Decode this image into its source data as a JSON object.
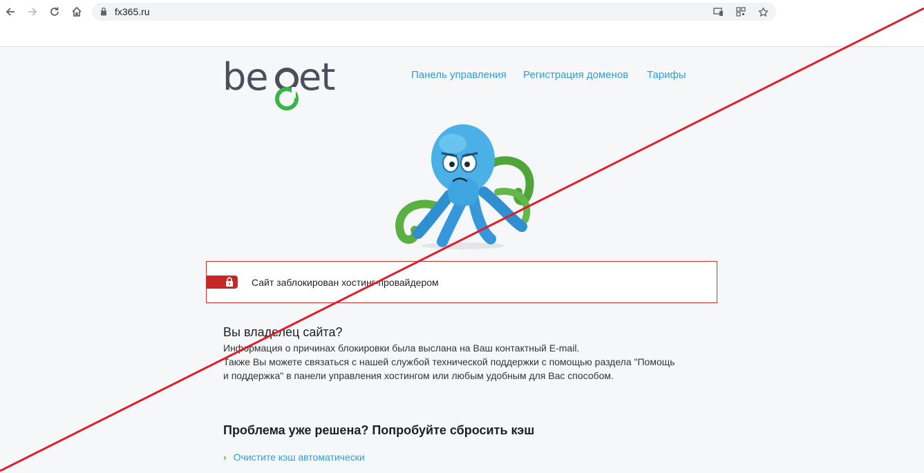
{
  "browser": {
    "url": "fx365.ru",
    "back_icon": "arrow-left-icon",
    "forward_icon": "arrow-right-icon",
    "reload_icon": "reload-icon",
    "home_icon": "home-icon"
  },
  "logo": {
    "text": "beget"
  },
  "nav": {
    "items": [
      {
        "label": "Панель управления"
      },
      {
        "label": "Регистрация доменов"
      },
      {
        "label": "Тарифы"
      }
    ]
  },
  "alert": {
    "text": "Сайт заблокирован хостинг-провайдером",
    "color": "#c62828"
  },
  "owner": {
    "heading": "Вы владелец сайта?",
    "line1": "Информация о причинах блокировки была выслана на Ваш контактный E-mail.",
    "line2": "Также Вы можете связаться с нашей службой технической поддержки с помощью раздела \"Помощь",
    "line3": "и поддержка\" в панели управления хостингом или любым удобным для Вас способом."
  },
  "solved": {
    "heading": "Проблема уже решена? Попробуйте сбросить кэш",
    "link": "Очистите кэш автоматически"
  },
  "colors": {
    "accent": "#2d9fd6",
    "alert_red": "#c62828",
    "strike_red": "#e01e2b",
    "chevron_green": "#6ab43e"
  }
}
